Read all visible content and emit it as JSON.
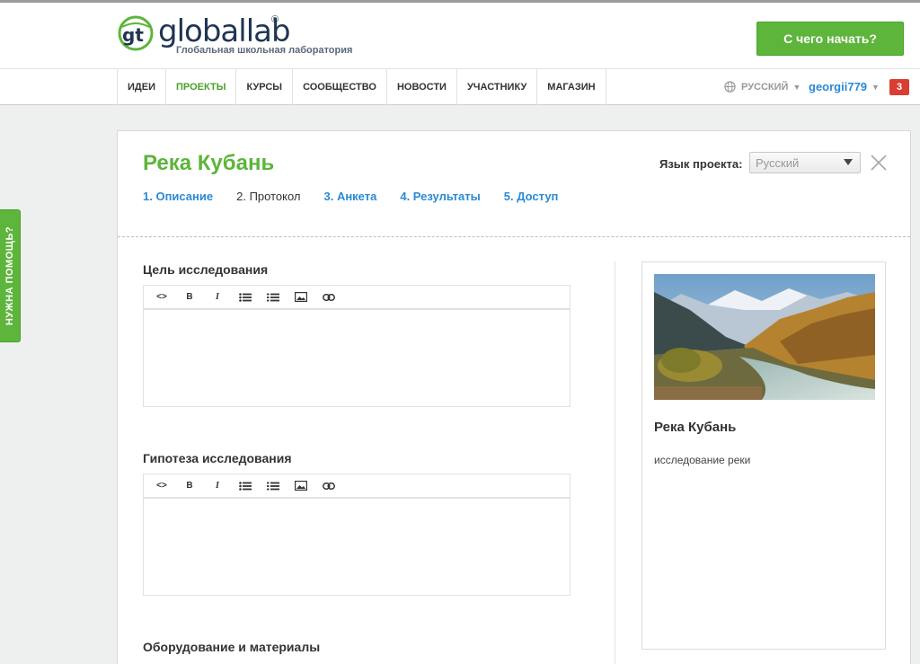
{
  "header": {
    "logo_text": "globallab",
    "logo_reg": "®",
    "logo_subtitle": "Глобальная школьная лаборатория",
    "start_button": "С чего начать?"
  },
  "nav": {
    "items": [
      "ИДЕИ",
      "ПРОЕКТЫ",
      "КУРСЫ",
      "СООБЩЕСТВО",
      "НОВОСТИ",
      "УЧАСТНИКУ",
      "МАГАЗИН"
    ],
    "active": "ПРОЕКТЫ",
    "language": "РУССКИЙ",
    "username": "georgii779",
    "notifications": "3"
  },
  "help_tab": "НУЖНА ПОМОЩЬ?",
  "project": {
    "title": "Река Кубань",
    "language_label": "Язык проекта:",
    "language_value": "Русский",
    "steps": [
      "1. Описание",
      "2. Протокол",
      "3. Анкета",
      "4. Результаты",
      "5. Доступ"
    ],
    "current_step": "2. Протокол"
  },
  "form": {
    "goal_label": "Цель исследования",
    "hypothesis_label": "Гипотеза исследования",
    "equipment_label": "Оборудование и материалы",
    "toolbar_icons": [
      "code-icon",
      "bold-icon",
      "italic-icon",
      "bullet-list-icon",
      "numbered-list-icon",
      "image-icon",
      "link-icon"
    ],
    "toolbar_labels": [
      "<>",
      "B",
      "I"
    ]
  },
  "preview": {
    "title": "Река Кубань",
    "description": "исследование реки"
  },
  "colors": {
    "brand_green": "#5db53b",
    "link_blue": "#2a8ad4",
    "logo_navy": "#1f3553",
    "badge_red": "#d93d33"
  }
}
